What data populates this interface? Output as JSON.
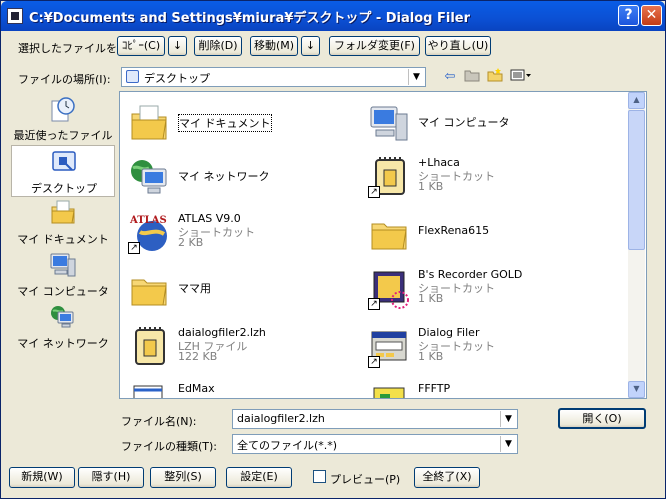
{
  "window": {
    "title": "C:¥Documents and Settings¥miura¥デスクトップ - Dialog Filer",
    "help_glyph": "?",
    "close_glyph": "✕"
  },
  "toolbar": {
    "selected_label": "選択したファイルを",
    "copy": "ｺﾋﾟｰ(C)",
    "down_arrow": "↓",
    "delete": "削除(D)",
    "move": "移動(M)",
    "change_folder": "フォルダ変更(F)",
    "redo": "やり直し(U)"
  },
  "location": {
    "label": "ファイルの場所(I):",
    "value": "デスクトップ",
    "dropdown_glyph": "▼"
  },
  "nav_icons": [
    "back-arrow-icon",
    "up-folder-icon",
    "new-folder-icon",
    "view-menu-icon"
  ],
  "places": [
    {
      "label": "最近使ったファイル",
      "icon": "recent-icon"
    },
    {
      "label": "デスクトップ",
      "icon": "desktop-icon"
    },
    {
      "label": "マイ ドキュメント",
      "icon": "my-documents-icon"
    },
    {
      "label": "マイ コンピュータ",
      "icon": "my-computer-icon"
    },
    {
      "label": "マイ ネットワーク",
      "icon": "my-network-icon"
    }
  ],
  "files": [
    {
      "name": "マイ ドキュメント",
      "icon": "my-documents-icon"
    },
    {
      "name": "マイ コンピュータ",
      "icon": "my-computer-icon"
    },
    {
      "name": "マイ ネットワーク",
      "icon": "my-network-icon"
    },
    {
      "name": "+Lhaca",
      "type": "ショートカット",
      "size": "1 KB",
      "icon": "lhaca-shortcut-icon"
    },
    {
      "name": "ATLAS V9.0",
      "type": "ショートカット",
      "size": "2 KB",
      "icon": "atlas-shortcut-icon"
    },
    {
      "name": "FlexRena615",
      "icon": "folder-icon"
    },
    {
      "name": "ママ用",
      "icon": "folder-icon"
    },
    {
      "name": "B's Recorder GOLD",
      "type": "ショートカット",
      "size": "1 KB",
      "icon": "bs-recorder-shortcut-icon"
    },
    {
      "name": "daialogfiler2.lzh",
      "type": "LZH ファイル",
      "size": "122 KB",
      "icon": "lzh-file-icon"
    },
    {
      "name": "Dialog Filer",
      "type": "ショートカット",
      "size": "1 KB",
      "icon": "dialog-filer-shortcut-icon"
    },
    {
      "name": "EdMax",
      "icon": "edmax-icon"
    },
    {
      "name": "FFFTP",
      "icon": "ffftp-icon"
    }
  ],
  "filename": {
    "label": "ファイル名(N):",
    "value": "daialogfiler2.lzh",
    "dropdown_glyph": "▼"
  },
  "filetype": {
    "label": "ファイルの種類(T):",
    "value": "全てのファイル(*.*)",
    "dropdown_glyph": "▼"
  },
  "open_button": "開く(O)",
  "bottom": {
    "new": "新規(W)",
    "hide": "隠す(H)",
    "arrange": "整列(S)",
    "settings": "設定(E)",
    "preview": "プレビュー(P)",
    "quit_all": "全終了(X)"
  },
  "scroll": {
    "up_glyph": "▲",
    "down_glyph": "▼"
  },
  "colors": {
    "titlebar": "#0a5ce6",
    "face": "#ece9d8",
    "selection_text": "#000000"
  }
}
